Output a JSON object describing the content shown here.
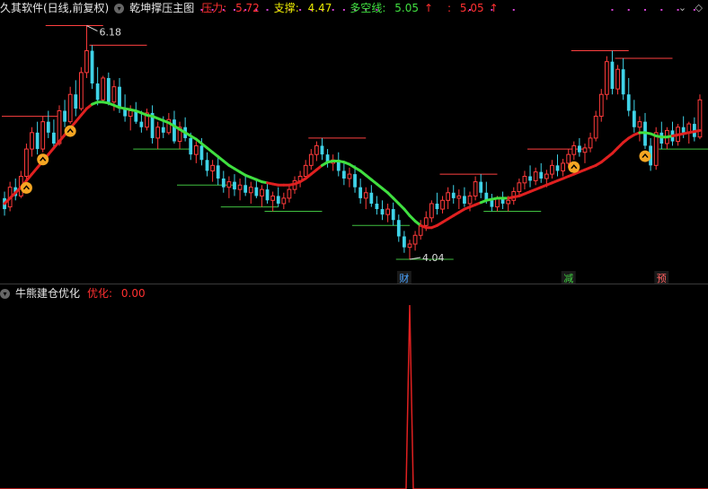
{
  "header": {
    "app_title": "久其软件(日线,前复权)",
    "indicator_name": "乾坤撑压主图",
    "pressure_label": "压力:",
    "pressure_value": "5.72",
    "support_label": "支撑:",
    "support_value": "4.47",
    "longshort_label": "多空线:",
    "longshort_value": "5.05",
    "longshort_arrow": "↑",
    "extra_label": ":",
    "extra_value": "5.05",
    "extra_arrow": "↑"
  },
  "sub_header": {
    "indicator_name": "牛熊建仓优化",
    "value_label": "优化:",
    "value": "0.00"
  },
  "icons": [
    "chevron-down-icon",
    "diamond-icon"
  ],
  "colors": {
    "background": "#000000",
    "up": "#ff3b3b",
    "down": "#3fd3e8",
    "bull_line": "#e02020",
    "bear_line": "#40e040",
    "level_up": "#ff4040",
    "level_down": "#40c040",
    "magenta": "#d040d0",
    "pressure": "#ff3030",
    "support": "#e6e600",
    "longshort": "#40e040"
  },
  "chart_data": [
    {
      "type": "candlestick",
      "annotations": {
        "high_label": "6.18",
        "low_label": "4.04",
        "markers": [
          {
            "text": "财",
            "color": "#4aa3ff"
          },
          {
            "text": "减",
            "color": "#40d040"
          },
          {
            "text": "预",
            "color": "#ff6060"
          }
        ]
      },
      "ohlc": [
        [
          4.6,
          4.66,
          4.44,
          4.5
        ],
        [
          4.52,
          4.75,
          4.48,
          4.7
        ],
        [
          4.7,
          4.78,
          4.58,
          4.62
        ],
        [
          4.62,
          4.85,
          4.6,
          4.8
        ],
        [
          4.8,
          5.1,
          4.76,
          5.05
        ],
        [
          5.05,
          5.25,
          4.98,
          5.2
        ],
        [
          5.2,
          5.3,
          5.0,
          5.05
        ],
        [
          5.05,
          5.35,
          5.02,
          5.3
        ],
        [
          5.3,
          5.4,
          5.15,
          5.2
        ],
        [
          5.2,
          5.32,
          5.05,
          5.1
        ],
        [
          5.1,
          5.45,
          5.08,
          5.4
        ],
        [
          5.4,
          5.5,
          5.25,
          5.3
        ],
        [
          5.3,
          5.62,
          5.28,
          5.55
        ],
        [
          5.55,
          5.68,
          5.35,
          5.42
        ],
        [
          5.42,
          5.8,
          5.4,
          5.75
        ],
        [
          5.75,
          6.18,
          5.7,
          5.95
        ],
        [
          5.95,
          6.0,
          5.6,
          5.65
        ],
        [
          5.65,
          5.8,
          5.45,
          5.5
        ],
        [
          5.5,
          5.72,
          5.48,
          5.7
        ],
        [
          5.7,
          5.75,
          5.45,
          5.48
        ],
        [
          5.48,
          5.68,
          5.4,
          5.62
        ],
        [
          5.62,
          5.7,
          5.38,
          5.42
        ],
        [
          5.42,
          5.55,
          5.3,
          5.35
        ],
        [
          5.35,
          5.45,
          5.22,
          5.4
        ],
        [
          5.4,
          5.48,
          5.28,
          5.3
        ],
        [
          5.3,
          5.4,
          5.2,
          5.25
        ],
        [
          5.25,
          5.42,
          5.22,
          5.38
        ],
        [
          5.38,
          5.45,
          5.1,
          5.15
        ],
        [
          5.15,
          5.3,
          5.05,
          5.25
        ],
        [
          5.25,
          5.35,
          5.15,
          5.2
        ],
        [
          5.2,
          5.38,
          5.18,
          5.32
        ],
        [
          5.32,
          5.4,
          5.1,
          5.12
        ],
        [
          5.12,
          5.3,
          5.05,
          5.25
        ],
        [
          5.25,
          5.34,
          5.12,
          5.15
        ],
        [
          5.15,
          5.2,
          4.95,
          5.0
        ],
        [
          5.0,
          5.12,
          4.92,
          5.08
        ],
        [
          5.08,
          5.15,
          4.9,
          4.95
        ],
        [
          4.95,
          5.02,
          4.8,
          4.85
        ],
        [
          4.85,
          4.95,
          4.75,
          4.9
        ],
        [
          4.9,
          4.98,
          4.72,
          4.78
        ],
        [
          4.78,
          4.85,
          4.65,
          4.7
        ],
        [
          4.7,
          4.8,
          4.6,
          4.75
        ],
        [
          4.75,
          4.82,
          4.62,
          4.68
        ],
        [
          4.68,
          4.78,
          4.58,
          4.72
        ],
        [
          4.72,
          4.8,
          4.62,
          4.65
        ],
        [
          4.65,
          4.75,
          4.55,
          4.7
        ],
        [
          4.7,
          4.78,
          4.6,
          4.62
        ],
        [
          4.62,
          4.72,
          4.52,
          4.68
        ],
        [
          4.68,
          4.74,
          4.55,
          4.58
        ],
        [
          4.58,
          4.66,
          4.48,
          4.62
        ],
        [
          4.62,
          4.7,
          4.52,
          4.55
        ],
        [
          4.55,
          4.65,
          4.5,
          4.6
        ],
        [
          4.6,
          4.72,
          4.56,
          4.68
        ],
        [
          4.68,
          4.8,
          4.64,
          4.76
        ],
        [
          4.76,
          4.85,
          4.7,
          4.8
        ],
        [
          4.8,
          4.95,
          4.78,
          4.9
        ],
        [
          4.9,
          5.05,
          4.86,
          5.0
        ],
        [
          5.0,
          5.12,
          4.94,
          5.08
        ],
        [
          5.08,
          5.15,
          4.95,
          5.0
        ],
        [
          5.0,
          5.05,
          4.88,
          4.92
        ],
        [
          4.92,
          5.0,
          4.85,
          4.95
        ],
        [
          4.95,
          5.02,
          4.8,
          4.85
        ],
        [
          4.85,
          4.92,
          4.72,
          4.78
        ],
        [
          4.78,
          4.88,
          4.7,
          4.82
        ],
        [
          4.82,
          4.9,
          4.65,
          4.7
        ],
        [
          4.7,
          4.78,
          4.55,
          4.6
        ],
        [
          4.6,
          4.7,
          4.5,
          4.65
        ],
        [
          4.65,
          4.72,
          4.52,
          4.55
        ],
        [
          4.55,
          4.62,
          4.45,
          4.5
        ],
        [
          4.5,
          4.58,
          4.4,
          4.45
        ],
        [
          4.45,
          4.55,
          4.38,
          4.5
        ],
        [
          4.5,
          4.56,
          4.35,
          4.4
        ],
        [
          4.4,
          4.45,
          4.2,
          4.25
        ],
        [
          4.25,
          4.3,
          4.1,
          4.15
        ],
        [
          4.15,
          4.22,
          4.04,
          4.18
        ],
        [
          4.18,
          4.3,
          4.12,
          4.26
        ],
        [
          4.26,
          4.4,
          4.22,
          4.35
        ],
        [
          4.35,
          4.48,
          4.3,
          4.42
        ],
        [
          4.42,
          4.58,
          4.38,
          4.55
        ],
        [
          4.55,
          4.65,
          4.45,
          4.5
        ],
        [
          4.5,
          4.62,
          4.46,
          4.58
        ],
        [
          4.58,
          4.7,
          4.5,
          4.65
        ],
        [
          4.65,
          4.72,
          4.55,
          4.6
        ],
        [
          4.6,
          4.68,
          4.5,
          4.62
        ],
        [
          4.62,
          4.7,
          4.52,
          4.55
        ],
        [
          4.55,
          4.66,
          4.48,
          4.62
        ],
        [
          4.62,
          4.8,
          4.58,
          4.75
        ],
        [
          4.75,
          4.82,
          4.6,
          4.65
        ],
        [
          4.65,
          4.75,
          4.55,
          4.58
        ],
        [
          4.58,
          4.64,
          4.48,
          4.52
        ],
        [
          4.52,
          4.62,
          4.48,
          4.6
        ],
        [
          4.6,
          4.66,
          4.5,
          4.55
        ],
        [
          4.55,
          4.62,
          4.48,
          4.58
        ],
        [
          4.58,
          4.7,
          4.54,
          4.66
        ],
        [
          4.66,
          4.78,
          4.62,
          4.74
        ],
        [
          4.74,
          4.85,
          4.68,
          4.8
        ],
        [
          4.8,
          4.9,
          4.7,
          4.76
        ],
        [
          4.76,
          4.88,
          4.72,
          4.84
        ],
        [
          4.84,
          4.92,
          4.74,
          4.78
        ],
        [
          4.78,
          4.86,
          4.7,
          4.82
        ],
        [
          4.82,
          4.95,
          4.78,
          4.9
        ],
        [
          4.9,
          5.0,
          4.8,
          4.85
        ],
        [
          4.85,
          4.96,
          4.8,
          4.92
        ],
        [
          4.92,
          5.05,
          4.88,
          5.0
        ],
        [
          5.0,
          5.12,
          4.95,
          5.08
        ],
        [
          5.08,
          5.15,
          4.98,
          5.02
        ],
        [
          5.02,
          5.1,
          4.92,
          5.06
        ],
        [
          5.06,
          5.2,
          5.02,
          5.15
        ],
        [
          5.15,
          5.4,
          5.12,
          5.35
        ],
        [
          5.35,
          5.6,
          5.3,
          5.55
        ],
        [
          5.55,
          5.9,
          5.5,
          5.85
        ],
        [
          5.85,
          5.95,
          5.55,
          5.6
        ],
        [
          5.6,
          5.82,
          5.55,
          5.78
        ],
        [
          5.78,
          5.88,
          5.5,
          5.55
        ],
        [
          5.55,
          5.7,
          5.35,
          5.4
        ],
        [
          5.4,
          5.5,
          5.2,
          5.25
        ],
        [
          5.25,
          5.35,
          5.12,
          5.3
        ],
        [
          5.3,
          5.38,
          5.05,
          5.08
        ],
        [
          5.08,
          5.15,
          4.85,
          4.9
        ],
        [
          4.9,
          5.25,
          4.86,
          5.2
        ],
        [
          5.2,
          5.3,
          5.05,
          5.1
        ],
        [
          5.1,
          5.25,
          5.05,
          5.22
        ],
        [
          5.22,
          5.3,
          5.08,
          5.12
        ],
        [
          5.12,
          5.28,
          5.08,
          5.25
        ],
        [
          5.25,
          5.35,
          5.15,
          5.2
        ],
        [
          5.2,
          5.3,
          5.1,
          5.28
        ],
        [
          5.28,
          5.34,
          5.12,
          5.16
        ],
        [
          5.16,
          5.55,
          5.14,
          5.5
        ]
      ],
      "ma_line": [
        4.55,
        4.6,
        4.65,
        4.7,
        4.76,
        4.82,
        4.88,
        4.94,
        5.0,
        5.06,
        5.12,
        5.18,
        5.24,
        5.3,
        5.36,
        5.42,
        5.46,
        5.48,
        5.48,
        5.47,
        5.45,
        5.43,
        5.42,
        5.41,
        5.4,
        5.38,
        5.36,
        5.35,
        5.33,
        5.31,
        5.29,
        5.26,
        5.23,
        5.2,
        5.17,
        5.14,
        5.1,
        5.06,
        5.02,
        4.98,
        4.94,
        4.9,
        4.87,
        4.84,
        4.81,
        4.79,
        4.77,
        4.75,
        4.74,
        4.73,
        4.72,
        4.72,
        4.72,
        4.73,
        4.75,
        4.78,
        4.82,
        4.86,
        4.9,
        4.93,
        4.94,
        4.94,
        4.93,
        4.91,
        4.88,
        4.85,
        4.81,
        4.77,
        4.73,
        4.69,
        4.65,
        4.6,
        4.55,
        4.5,
        4.44,
        4.39,
        4.35,
        4.33,
        4.33,
        4.35,
        4.38,
        4.41,
        4.44,
        4.47,
        4.5,
        4.52,
        4.54,
        4.56,
        4.58,
        4.59,
        4.6,
        4.6,
        4.6,
        4.61,
        4.62,
        4.64,
        4.66,
        4.68,
        4.7,
        4.72,
        4.74,
        4.76,
        4.78,
        4.8,
        4.82,
        4.84,
        4.86,
        4.88,
        4.9,
        4.93,
        4.97,
        5.01,
        5.06,
        5.11,
        5.15,
        5.18,
        5.2,
        5.2,
        5.19,
        5.17,
        5.16,
        5.16,
        5.17,
        5.18,
        5.19,
        5.2,
        5.21,
        5.22,
        5.23,
        5.24
      ],
      "ma_trend": [
        1,
        1,
        1,
        1,
        1,
        1,
        1,
        1,
        1,
        1,
        1,
        1,
        1,
        1,
        1,
        1,
        1,
        0,
        0,
        0,
        0,
        0,
        0,
        0,
        0,
        0,
        0,
        0,
        0,
        0,
        0,
        0,
        0,
        0,
        0,
        0,
        0,
        0,
        0,
        0,
        0,
        0,
        0,
        0,
        0,
        0,
        0,
        0,
        0,
        1,
        1,
        1,
        1,
        1,
        1,
        1,
        1,
        1,
        1,
        0,
        0,
        0,
        0,
        0,
        0,
        0,
        0,
        0,
        0,
        0,
        0,
        0,
        0,
        0,
        0,
        0,
        0,
        1,
        1,
        1,
        1,
        1,
        1,
        1,
        1,
        1,
        1,
        1,
        0,
        0,
        0,
        0,
        0,
        1,
        1,
        1,
        1,
        1,
        1,
        1,
        1,
        1,
        1,
        1,
        1,
        1,
        1,
        1,
        1,
        1,
        1,
        1,
        1,
        1,
        1,
        1,
        1,
        0,
        0,
        0,
        0,
        0,
        0,
        1,
        1,
        1,
        1,
        1,
        1,
        1,
        1,
        1
      ],
      "ylim": [
        3.95,
        6.25
      ]
    },
    {
      "type": "line",
      "series_spike_index": 74,
      "values_note_none": "",
      "ylim": [
        0,
        1
      ]
    }
  ]
}
